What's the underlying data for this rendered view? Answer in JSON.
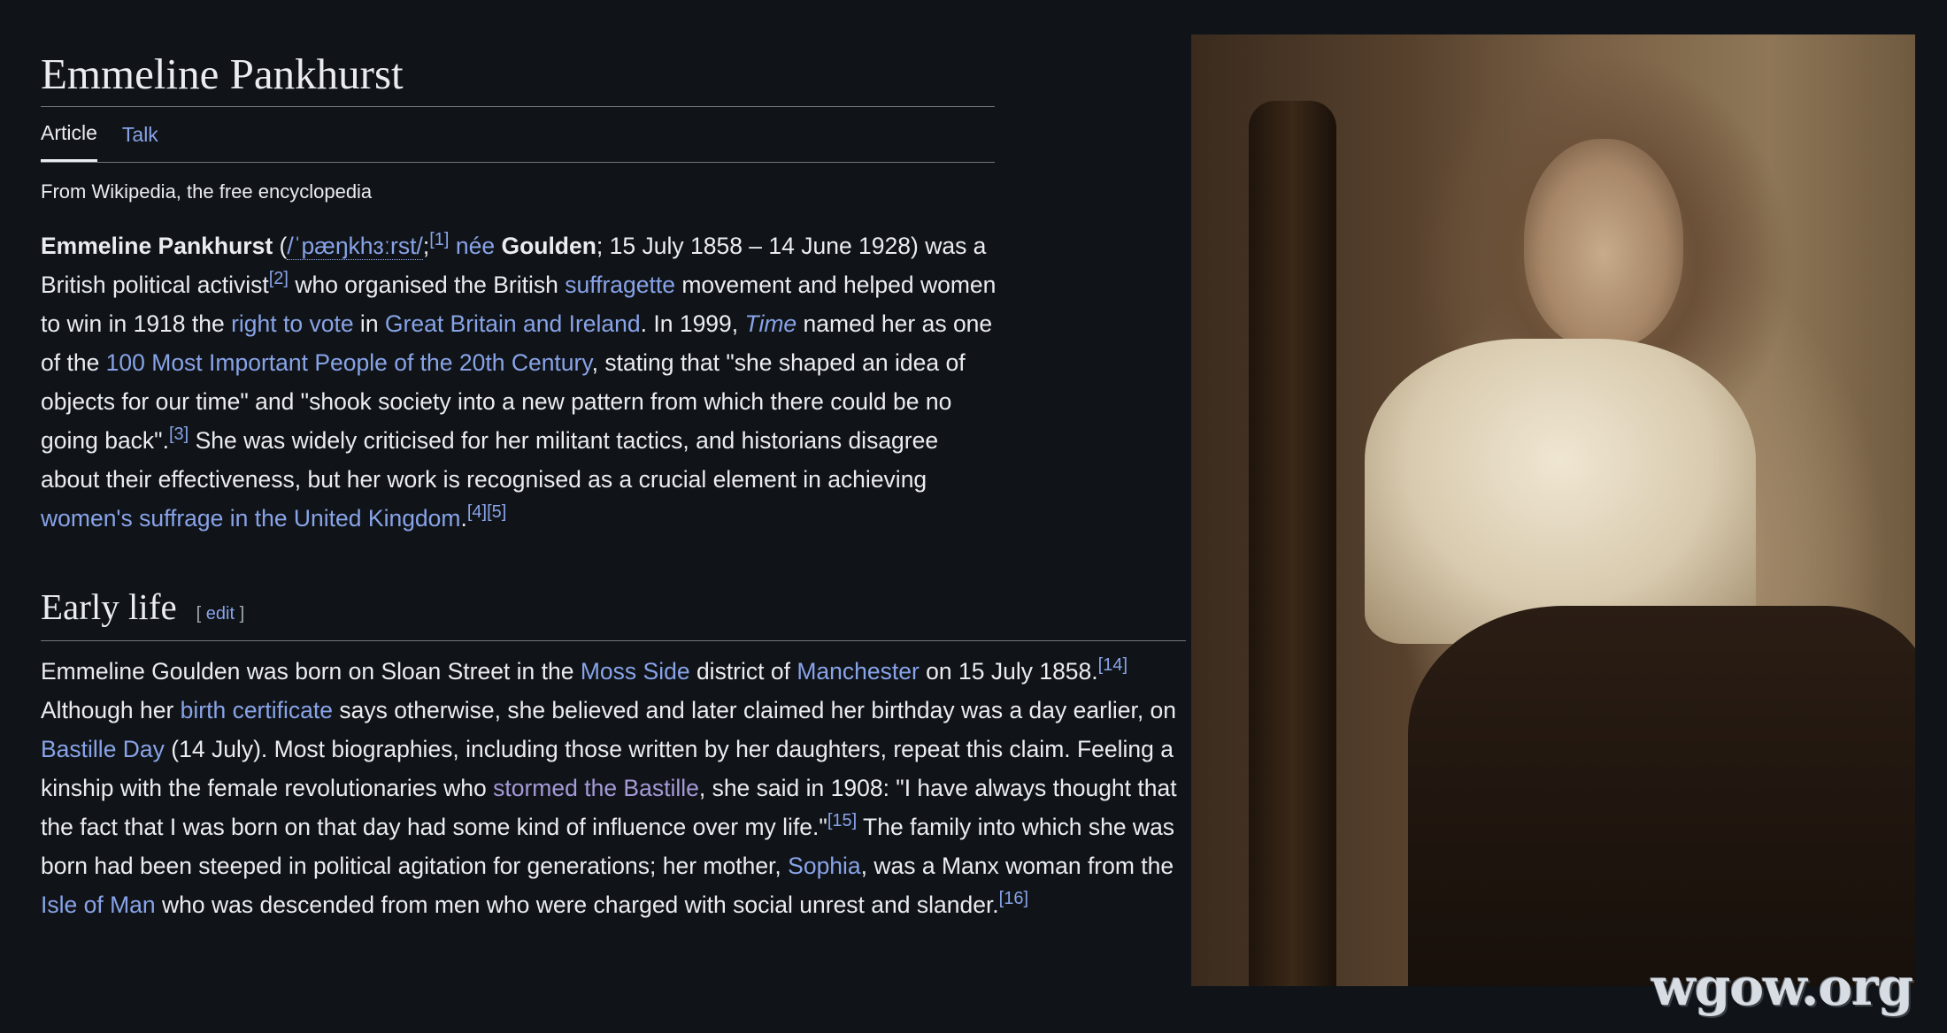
{
  "page": {
    "title": "Emmeline Pankhurst",
    "tabs": [
      {
        "label": "Article",
        "selected": true
      },
      {
        "label": "Talk",
        "selected": false
      }
    ],
    "tagline": "From Wikipedia, the free encyclopedia"
  },
  "lead": {
    "name_bold": "Emmeline Pankhurst",
    "open_paren": " (",
    "ipa": "/ˈpæŋkhɜːrst/",
    "semicolon": ";",
    "ref1": "[1]",
    "space1": " ",
    "nee_link": "née",
    "space2": " ",
    "maiden_bold": "Goulden",
    "t1": "; 15 July 1858 – 14 June 1928) was a British political activist",
    "ref2": "[2]",
    "t2": " who organised the British ",
    "link_suffragette": "suffragette",
    "t3": " movement and helped women to win in 1918 the ",
    "link_right_to_vote": "right to vote",
    "t4": " in ",
    "link_gb_ireland": "Great Britain and Ireland",
    "t5": ". In 1999, ",
    "link_time": "Time",
    "t6": " named her as one of the ",
    "link_100": "100 Most Important People of the 20th Century",
    "t7": ", stating that \"she shaped an idea of objects for our time\" and \"shook society into a new pattern from which there could be no going back\".",
    "ref3": "[3]",
    "t8": " She was widely criticised for her militant tactics, and historians disagree about their effectiveness, but her work is recognised as a crucial element in achieving ",
    "link_womens_suffrage": "women's suffrage in the United Kingdom",
    "t9": ".",
    "ref4": "[4]",
    "ref5": "[5]"
  },
  "early_life": {
    "heading": "Early life",
    "edit_open": "[ ",
    "edit_label": "edit",
    "edit_close": " ]",
    "t1": "Emmeline Goulden was born on Sloan Street in the ",
    "link_moss_side": "Moss Side",
    "t2": " district of ",
    "link_manchester": "Manchester",
    "t3": " on 15 July 1858.",
    "ref14": "[14]",
    "t4": " Although her ",
    "link_birth_cert": "birth certificate",
    "t5": " says otherwise, she believed and later claimed her birthday was a day earlier, on ",
    "link_bastille_day": "Bastille Day",
    "t6": " (14 July). Most biographies, including those written by her daughters, repeat this claim. Feeling a kinship with the female revolutionaries who ",
    "link_stormed": "stormed the Bastille",
    "t7": ", she said in 1908: \"I have always thought that the fact that I was born on that day had some kind of influence over my life.\"",
    "ref15": "[15]",
    "t8": " The family into which she was born had been steeped in political agitation for generations; her mother, ",
    "link_sophia": "Sophia",
    "t9": ", was a Manx woman from the ",
    "link_isle_of_man": "Isle of Man",
    "t10": " who was descended from men who were charged with social unrest and slander.",
    "ref16": "[16]"
  },
  "watermark": "wgow.org",
  "colors": {
    "background": "#101418",
    "text": "#eaecf0",
    "link": "#88a3e8",
    "visited_link": "#a49ad8",
    "divider": "#72777d"
  }
}
